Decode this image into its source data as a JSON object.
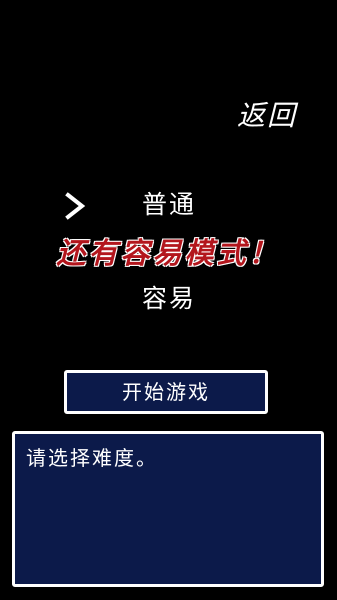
{
  "header": {
    "back_label": "返回"
  },
  "difficulty": {
    "options": [
      {
        "label": "普通",
        "selected": true
      },
      {
        "label": "容易",
        "selected": false
      }
    ],
    "banner": "还有容易模式！",
    "cursor_icon": "chevron-right-icon"
  },
  "actions": {
    "start_label": "开始游戏"
  },
  "message": {
    "text": "请选择难度。"
  },
  "colors": {
    "background": "#000000",
    "panel": "#0c1a4a",
    "border": "#ffffff",
    "banner_red": "#b3161d"
  }
}
